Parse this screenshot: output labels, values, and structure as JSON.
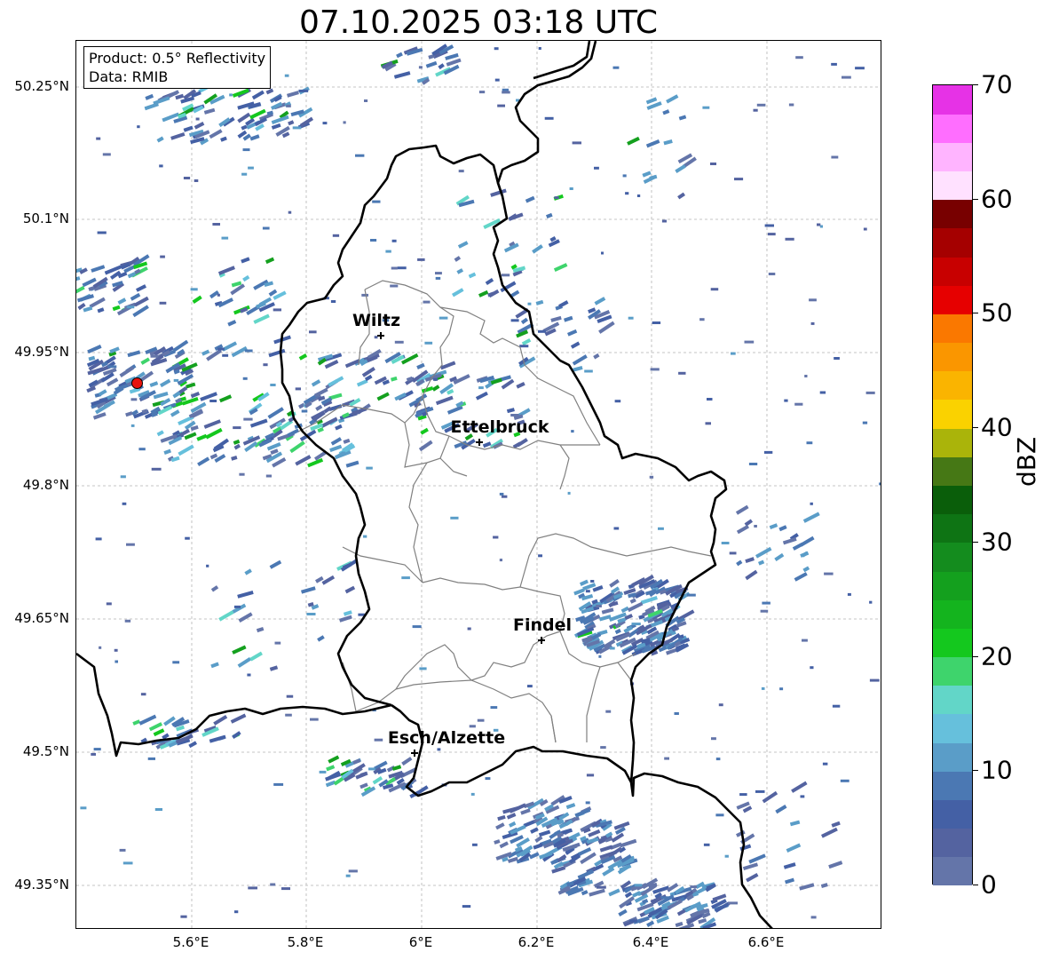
{
  "title": "07.10.2025 03:18 UTC",
  "info": {
    "product": "Product: 0.5° Reflectivity",
    "source": "Data: RMIB"
  },
  "lat_ticks": [
    "50.25°N",
    "50.1°N",
    "49.95°N",
    "49.8°N",
    "49.65°N",
    "49.5°N",
    "49.35°N"
  ],
  "lon_ticks": [
    "5.6°E",
    "5.8°E",
    "6°E",
    "6.2°E",
    "6.4°E",
    "6.6°E"
  ],
  "cities": [
    {
      "name": "Wiltz"
    },
    {
      "name": "Ettelbruck"
    },
    {
      "name": "Findel"
    },
    {
      "name": "Esch/Alzette"
    }
  ],
  "colorbar": {
    "label": "dBZ",
    "ticks": [
      "0",
      "10",
      "20",
      "30",
      "40",
      "50",
      "60",
      "70"
    ],
    "min": 0,
    "max": 70,
    "step": 2.5,
    "colors": [
      "#6475a9",
      "#5463a0",
      "#4460a5",
      "#4b78b3",
      "#5a9dc8",
      "#66c0dc",
      "#62d6c8",
      "#3ed46c",
      "#14c81e",
      "#14b41e",
      "#14a01e",
      "#148c1e",
      "#0e7414",
      "#0a5e0a",
      "#467815",
      "#aab40a",
      "#fad200",
      "#fab400",
      "#fa9600",
      "#fa7800",
      "#e60000",
      "#c80000",
      "#a50000",
      "#780000",
      "#ffe1ff",
      "#ffb4ff",
      "#ff6eff",
      "#e632e6"
    ]
  },
  "colors": {
    "border_country": "#000000",
    "border_canton": "#808080",
    "grid": "#b4b4b4",
    "radar_site": "#e8140f"
  }
}
